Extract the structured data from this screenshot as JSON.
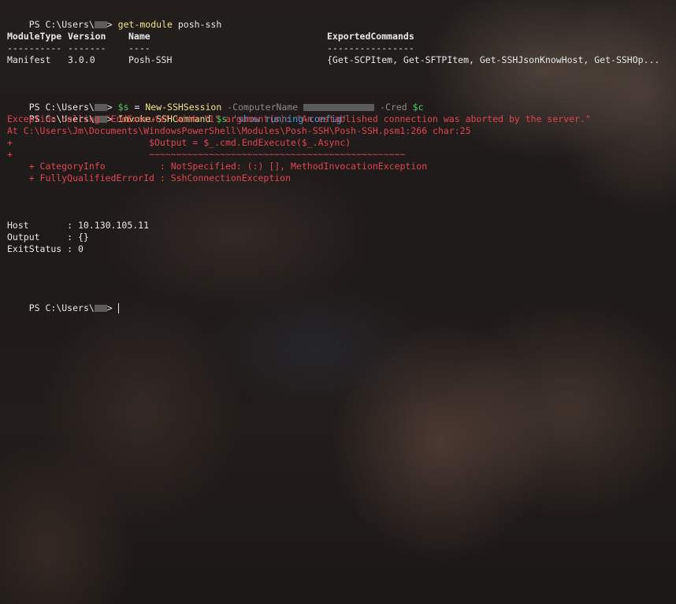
{
  "prompt": "PS C:\\Users\\",
  "prompt_suffix": ">",
  "cmd1": {
    "name": "get-module",
    "arg": "posh-ssh"
  },
  "module_table": {
    "headers": [
      "ModuleType",
      "Version",
      "Name",
      "ExportedCommands"
    ],
    "underlines": [
      "----------",
      "-------",
      "----",
      "----------------"
    ],
    "row": [
      "Manifest",
      "3.0.0",
      "Posh-SSH",
      "{Get-SCPItem, Get-SFTPItem, Get-SSHJsonKnowHost, Get-SSHOp..."
    ]
  },
  "cmd2": {
    "var": "$s",
    "eq": "=",
    "name": "New-SSHSession",
    "param1": "-ComputerName",
    "param2": "-Cred",
    "arg2": "$c"
  },
  "cmd3": {
    "name": "Invoke-SSHCommand",
    "var": "$s",
    "str": "'show running-config'"
  },
  "error": {
    "line1": "Exception calling \"EndExecute\" with \"1\" argument(s): \"An established connection was aborted by the server.\"",
    "line2": "At C:\\Users\\Jm\\Documents\\WindowsPowerShell\\Modules\\Posh-SSH\\Posh-SSH.psm1:266 char:25",
    "line3": "+                         $Output = $_.cmd.EndExecute($_.Async)",
    "line4": "+                         ~~~~~~~~~~~~~~~~~~~~~~~~~~~~~~~~~~~~~~~~~~~~~~~",
    "line5": "    + CategoryInfo          : NotSpecified: (:) [], MethodInvocationException",
    "line6": "    + FullyQualifiedErrorId : SshConnectionException"
  },
  "result": {
    "host": "Host       : 10.130.105.11",
    "output": "Output     : {}",
    "exitstatus": "ExitStatus : 0"
  },
  "colors": {
    "command": "#f2e58a",
    "variable": "#4fd266",
    "parameter": "#8a8a8a",
    "string": "#3aa6e0",
    "error": "#e2454f",
    "text": "#e8e8e8"
  }
}
